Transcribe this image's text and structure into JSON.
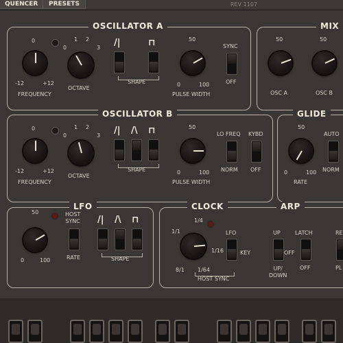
{
  "topbar": {
    "tabs": [
      "QUENCER",
      "PRESETS"
    ],
    "rev": "REV 1107"
  },
  "osc_a": {
    "title": "OSCILLATOR A",
    "freq": {
      "top": "0",
      "min": "-12",
      "max": "+12",
      "label": "FREQUENCY"
    },
    "octave": {
      "marks": [
        "0",
        "1",
        "2",
        "3"
      ],
      "label": "OCTAVE"
    },
    "shape_label": "SHAPE",
    "pw": {
      "top": "50",
      "min": "0",
      "max": "100",
      "label": "PULSE WIDTH"
    },
    "sync": {
      "label": "SYNC",
      "off": "OFF"
    }
  },
  "mix": {
    "title": "MIX",
    "osc_a": {
      "top": "50",
      "label": "OSC A"
    },
    "osc_b": {
      "top": "50",
      "label": "OSC B"
    }
  },
  "osc_b": {
    "title": "OSCILLATOR B",
    "freq": {
      "top": "0",
      "min": "-12",
      "max": "+12",
      "label": "FREQUENCY"
    },
    "octave": {
      "marks": [
        "0",
        "1",
        "2",
        "3"
      ],
      "label": "OCTAVE"
    },
    "shape_label": "SHAPE",
    "pw": {
      "top": "50",
      "min": "0",
      "max": "100",
      "label": "PULSE WIDTH"
    },
    "lofreq": {
      "label": "LO FREQ",
      "norm": "NORM"
    },
    "kybd": {
      "label": "KYBD",
      "off": "OFF"
    }
  },
  "glide": {
    "title": "GLIDE",
    "rate": {
      "top": "50",
      "min": "0",
      "max": "100",
      "label": "RATE"
    },
    "auto": {
      "label": "AUTO",
      "norm": "NORM"
    }
  },
  "lfo": {
    "title": "LFO",
    "rate": {
      "top": "50",
      "min": "0",
      "max": "100",
      "label": "RATE"
    },
    "host_sync": "HOST\nSYNC",
    "shape_label": "SHAPE"
  },
  "clock": {
    "title": "CLOCK",
    "marks": [
      "1/4",
      "1/1",
      "1/16",
      "8/1",
      "1/64"
    ],
    "lfo": "LFO",
    "key": "KEY",
    "host_sync": "HOST SYNC"
  },
  "arp": {
    "title": "ARP",
    "mode": {
      "up": "UP",
      "off": "OFF",
      "down": "UP/\nDOWN"
    },
    "latch": {
      "label": "LATCH",
      "off": "OFF"
    },
    "right": {
      "top": "RE",
      "bottom": "PL"
    }
  }
}
